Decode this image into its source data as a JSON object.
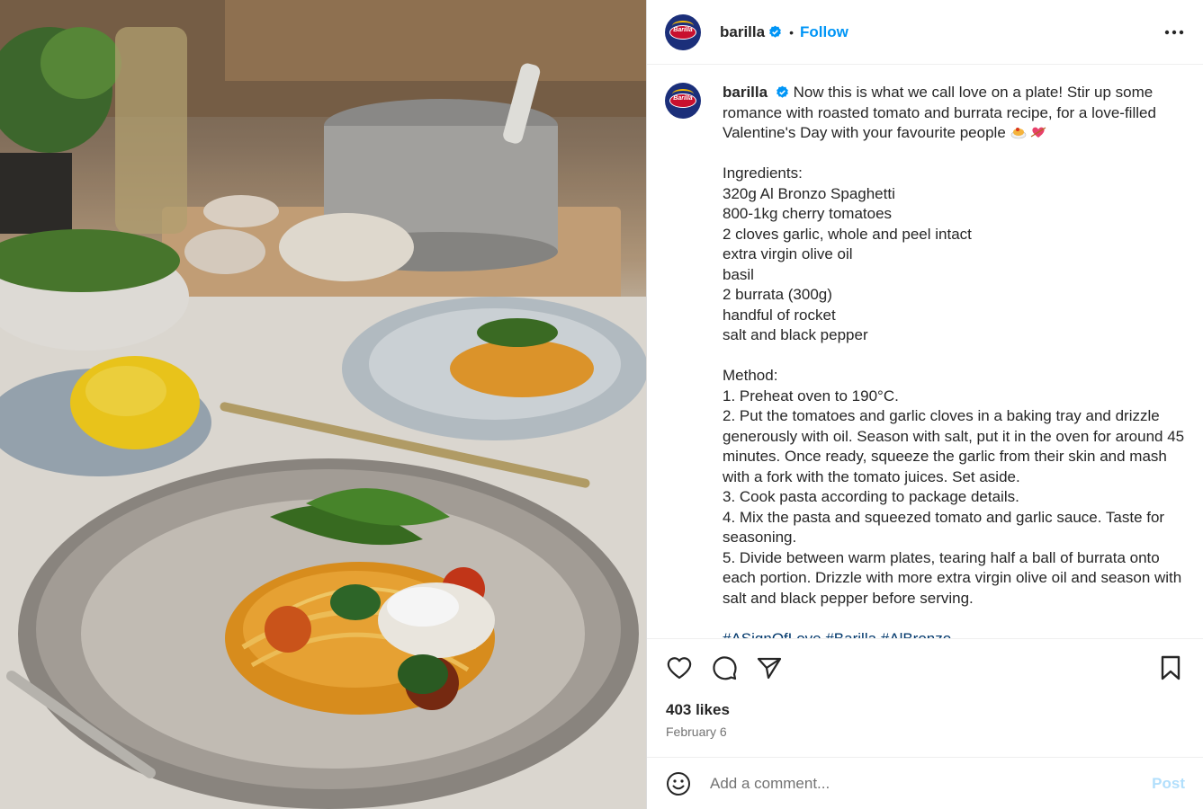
{
  "header": {
    "username": "barilla",
    "follow_label": "Follow",
    "dot": "•"
  },
  "caption": {
    "username": "barilla",
    "intro": "Now this is what we call love on a plate! Stir up some romance with roasted tomato and burrata recipe, for a love-filled Valentine's Day with your favourite people",
    "ingredients_title": "Ingredients:",
    "ingredients": [
      "320g Al Bronzo Spaghetti",
      "800-1kg cherry tomatoes",
      "2 cloves garlic, whole and peel intact",
      "extra virgin olive oil",
      "basil",
      "2 burrata (300g)",
      "handful of rocket",
      "salt and black pepper"
    ],
    "method_title": "Method:",
    "method": [
      "1. Preheat oven to 190°C.",
      "2. Put the tomatoes and garlic cloves in a baking tray and drizzle generously with oil. Season with salt, put it in the oven for around 45 minutes. Once ready, squeeze the garlic from their skin and mash with a fork with the tomato juices. Set aside.",
      "3. Cook pasta according to package details.",
      "4. Mix the pasta and squeezed tomato and garlic sauce. Taste for seasoning.",
      "5. Divide between warm plates, tearing half a ball of burrata onto each portion. Drizzle with more extra virgin olive oil and season with salt and black pepper before serving."
    ],
    "hashtags": "#ASignOfLove #Barilla #AlBronzo"
  },
  "stats": {
    "likes": "403 likes",
    "date": "February 6"
  },
  "comment": {
    "placeholder": "Add a comment...",
    "post_label": "Post"
  },
  "icons": {
    "like": "heart-icon",
    "comment": "comment-icon",
    "share": "share-icon",
    "save": "bookmark-icon",
    "more": "more-options-icon",
    "emoji": "emoji-icon",
    "verified": "verified-badge-icon"
  },
  "colors": {
    "link": "#0095f6",
    "verified": "#0095f6",
    "brand_blue": "#1b2f7a",
    "brand_red": "#c8102e",
    "post_disabled": "#b2dffc",
    "hashtag": "#00376b"
  }
}
